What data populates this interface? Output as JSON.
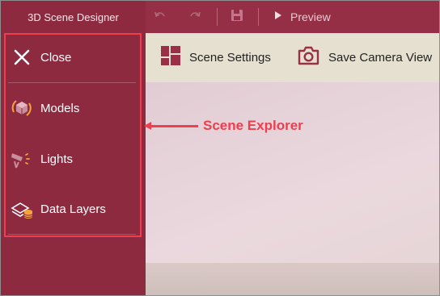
{
  "app": {
    "title": "3D Scene Designer"
  },
  "topbar": {
    "buttons": [
      {
        "icon": "undo-icon",
        "enabled": false
      },
      {
        "icon": "redo-icon",
        "enabled": false
      },
      {
        "icon": "save-icon",
        "enabled": false
      }
    ],
    "preview_label": "Preview",
    "preview_icon": "play-icon"
  },
  "toolbar": {
    "scene_settings_label": "Scene Settings",
    "scene_settings_icon": "dashboard-icon",
    "save_camera_label": "Save Camera View",
    "save_camera_icon": "camera-icon"
  },
  "sidebar": {
    "items": [
      {
        "label": "Close",
        "icon": "close-icon"
      },
      {
        "label": "Models",
        "icon": "cube-icon"
      },
      {
        "label": "Lights",
        "icon": "spotlight-icon"
      },
      {
        "label": "Data Layers",
        "icon": "layers-icon"
      }
    ]
  },
  "annotation": {
    "label": "Scene Explorer",
    "color": "#ef3e4e"
  },
  "colors": {
    "sidebar": "#8e2a40",
    "topbar": "#952f45",
    "toolbar": "#e6e0d0",
    "icon_accent": "#9a2f45",
    "model_icon_orange": "#f3a43a"
  }
}
